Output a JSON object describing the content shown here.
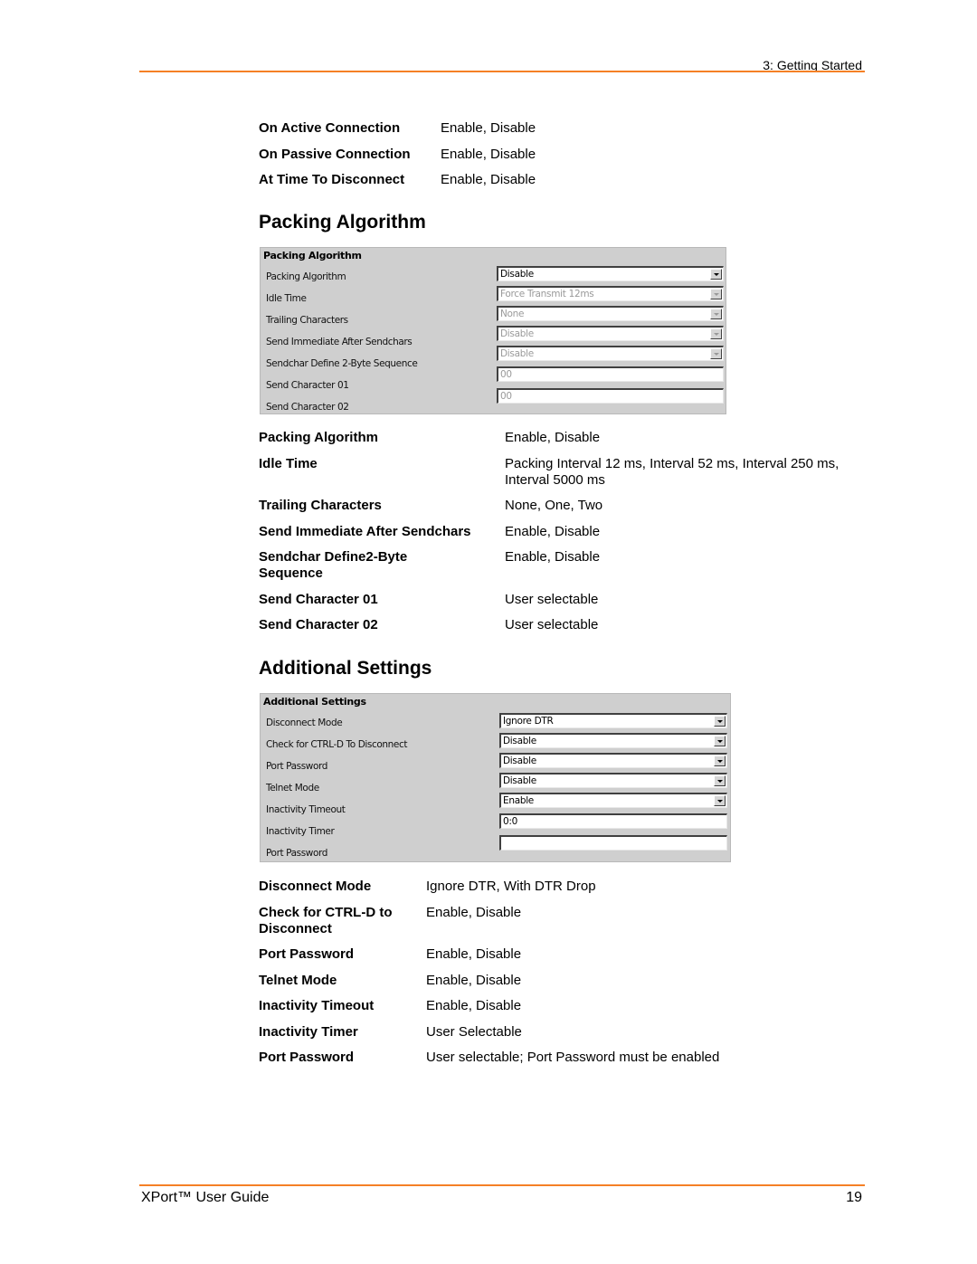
{
  "header": {
    "chapter": "3: Getting Started"
  },
  "footer": {
    "guide_title": "XPort™ User Guide",
    "page_number": "19"
  },
  "top_table": [
    {
      "term": "On Active Connection",
      "desc": "Enable, Disable"
    },
    {
      "term": "On Passive Connection",
      "desc": "Enable, Disable"
    },
    {
      "term": "At Time To Disconnect",
      "desc": "Enable, Disable"
    }
  ],
  "packing": {
    "title": "Packing Algorithm",
    "panel": {
      "title": "Packing Algorithm",
      "rows": [
        {
          "label": "Packing Algorithm",
          "type": "select",
          "value": "Disable",
          "disabled": false
        },
        {
          "label": "Idle Time",
          "type": "select",
          "value": "Force Transmit 12ms",
          "disabled": true
        },
        {
          "label": "Trailing Characters",
          "type": "select",
          "value": "None",
          "disabled": true
        },
        {
          "label": "Send Immediate After Sendchars",
          "type": "select",
          "value": "Disable",
          "disabled": true
        },
        {
          "label": "Sendchar Define 2-Byte Sequence",
          "type": "select",
          "value": "Disable",
          "disabled": true
        },
        {
          "label": "Send Character 01",
          "type": "text",
          "value": "00",
          "disabled": true
        },
        {
          "label": "Send Character 02",
          "type": "text",
          "value": "00",
          "disabled": true
        }
      ]
    },
    "table": [
      {
        "term": "Packing Algorithm",
        "desc": "Enable, Disable"
      },
      {
        "term": "Idle Time",
        "desc": "Packing Interval 12 ms, Interval 52 ms, Interval 250 ms, Interval 5000 ms"
      },
      {
        "term": "Trailing Characters",
        "desc": "None, One, Two"
      },
      {
        "term": "Send Immediate After Sendchars",
        "desc": "Enable, Disable"
      },
      {
        "term": "Sendchar Define2-Byte Sequence",
        "desc": "Enable, Disable"
      },
      {
        "term": "Send Character 01",
        "desc": "User selectable"
      },
      {
        "term": "Send Character 02",
        "desc": "User selectable"
      }
    ]
  },
  "additional": {
    "title": "Additional Settings",
    "panel": {
      "title": "Additional Settings",
      "rows": [
        {
          "label": "Disconnect Mode",
          "type": "select",
          "value": "Ignore DTR",
          "disabled": false
        },
        {
          "label": "Check for CTRL-D To Disconnect",
          "type": "select",
          "value": "Disable",
          "disabled": false
        },
        {
          "label": "Port Password",
          "type": "select",
          "value": "Disable",
          "disabled": false
        },
        {
          "label": "Telnet Mode",
          "type": "select",
          "value": "Disable",
          "disabled": false
        },
        {
          "label": "Inactivity Timeout",
          "type": "select",
          "value": "Enable",
          "disabled": false
        },
        {
          "label": "Inactivity Timer",
          "type": "text",
          "value": "0:0",
          "disabled": false
        },
        {
          "label": "Port Password",
          "type": "text",
          "value": "",
          "disabled": false
        }
      ]
    },
    "table": [
      {
        "term": "Disconnect Mode",
        "desc": "Ignore DTR, With DTR Drop"
      },
      {
        "term": "Check for CTRL-D to Disconnect",
        "desc": "Enable, Disable"
      },
      {
        "term": "Port Password",
        "desc": "Enable, Disable"
      },
      {
        "term": "Telnet Mode",
        "desc": "Enable, Disable"
      },
      {
        "term": "Inactivity Timeout",
        "desc": "Enable, Disable"
      },
      {
        "term": "Inactivity Timer",
        "desc": "User Selectable"
      },
      {
        "term": "Port Password",
        "desc": "User selectable; Port Password must be enabled"
      }
    ]
  }
}
